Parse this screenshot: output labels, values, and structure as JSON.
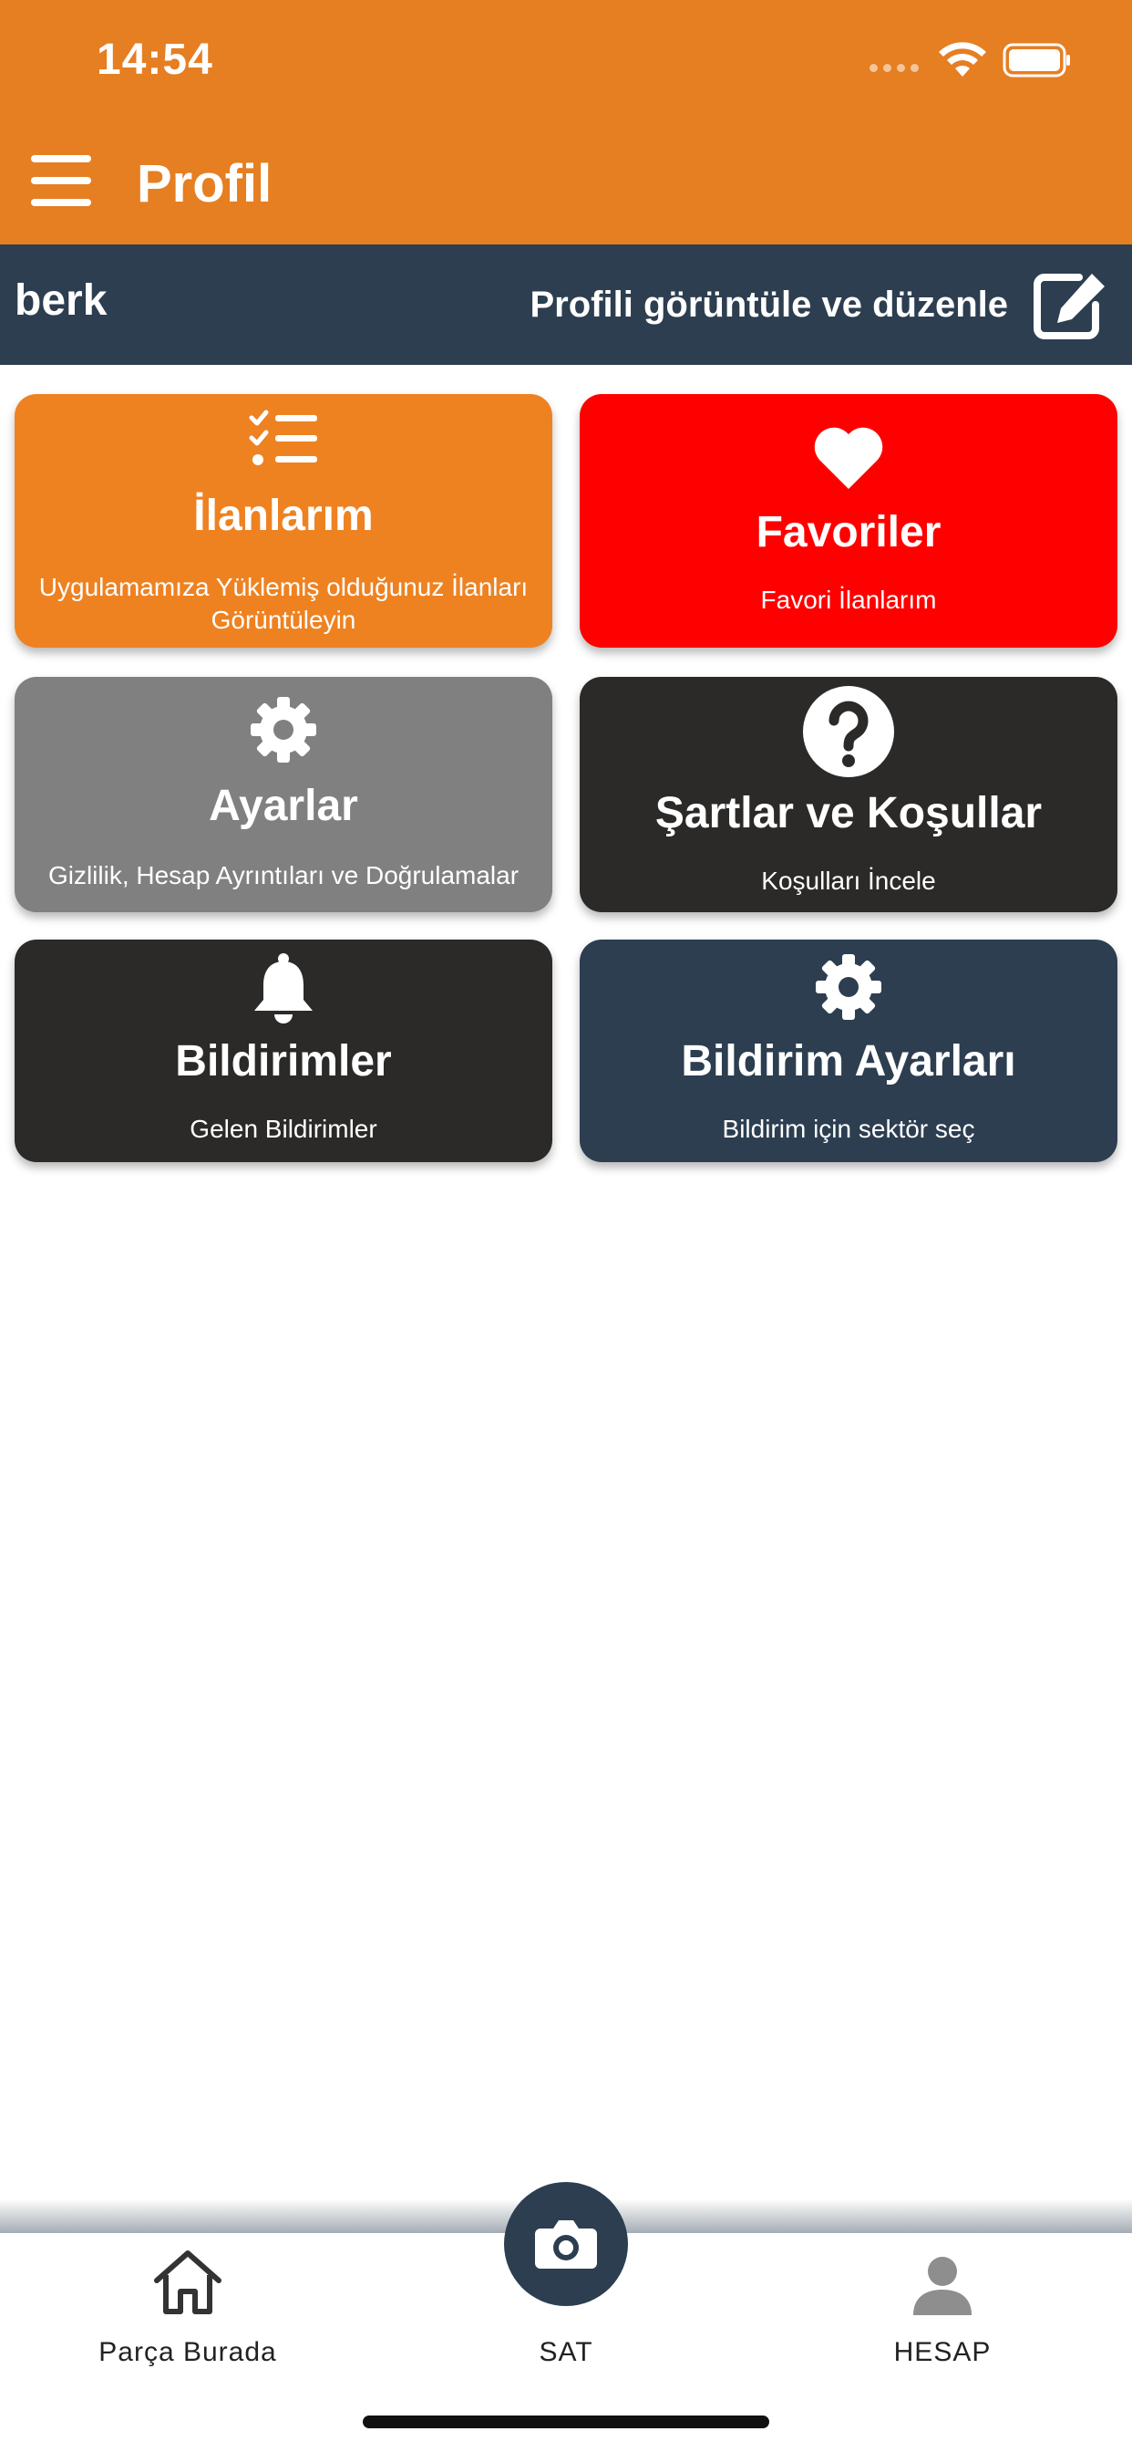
{
  "status_bar": {
    "time": "14:54"
  },
  "header": {
    "title": "Profil"
  },
  "user_bar": {
    "username": "berk",
    "edit_label": "Profili görüntüle ve düzenle"
  },
  "cards": [
    {
      "title": "İlanlarım",
      "subtitle": "Uygulamamıza Yüklemiş olduğunuz İlanları Görüntüleyin",
      "icon": "checklist-icon",
      "color": "#EE8221"
    },
    {
      "title": "Favoriler",
      "subtitle": "Favori İlanlarım",
      "icon": "heart-icon",
      "color": "#FF0000"
    },
    {
      "title": "Ayarlar",
      "subtitle": "Gizlilik, Hesap Ayrıntıları ve Doğrulamalar",
      "icon": "gear-icon",
      "color": "#808080"
    },
    {
      "title": "Şartlar ve Koşullar",
      "subtitle": "Koşulları İncele",
      "icon": "question-icon",
      "color": "#2B2A29"
    },
    {
      "title": "Bildirimler",
      "subtitle": "Gelen Bildirimler",
      "icon": "bell-icon",
      "color": "#2B2A29"
    },
    {
      "title": "Bildirim Ayarları",
      "subtitle": "Bildirim için sektör seç",
      "icon": "gear-icon",
      "color": "#2C3E50"
    }
  ],
  "tab_bar": {
    "home_label": "Parça Burada",
    "sat_label": "SAT",
    "account_label": "HESAP"
  },
  "colors": {
    "primary": "#E67E22",
    "dark": "#2C3E50"
  }
}
